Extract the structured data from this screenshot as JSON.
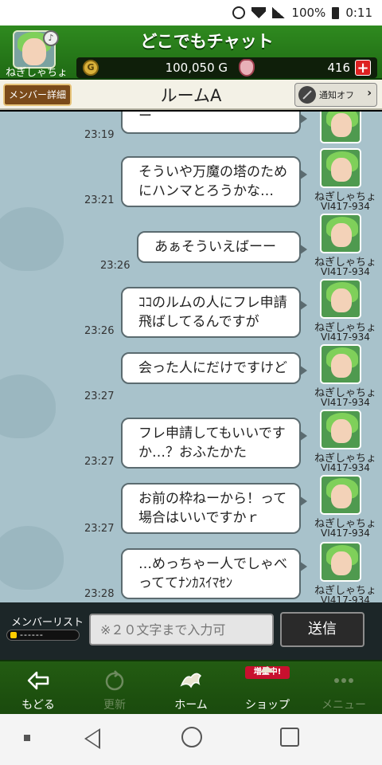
{
  "status_bar": {
    "battery": "100%",
    "time": "0:11"
  },
  "header": {
    "title": "どこでもチャット",
    "player_name": "ねぎしゃちょ",
    "gold_value": "100,050 G",
    "gem_value": "416",
    "coin_icon_text": "G"
  },
  "room_bar": {
    "member_detail_label": "メンバー詳細",
    "room_name": "ルームA",
    "notify_label": "通知オフ",
    "notify_chevron": "›"
  },
  "chat": {
    "partial_top": {
      "text": "ー",
      "time": "23:19"
    },
    "messages": [
      {
        "text": "そういや万魔の塔のためにハンマとろうかな…",
        "time": "23:21",
        "sender": "ねぎしゃちょ",
        "sender_id": "VI417-934"
      },
      {
        "text": "あぁそういえばーー",
        "time": "23:26",
        "sender": "ねぎしゃちょ",
        "sender_id": "VI417-934"
      },
      {
        "text": "ｺｺのルムの人にフレ申請飛ばしてるんですが",
        "time": "23:26",
        "sender": "ねぎしゃちょ",
        "sender_id": "VI417-934"
      },
      {
        "text": "会った人にだけですけど",
        "time": "23:27",
        "sender": "ねぎしゃちょ",
        "sender_id": "VI417-934"
      },
      {
        "text": "フレ申請してもいいですか…？おふたかた",
        "time": "23:27",
        "sender": "ねぎしゃちょ",
        "sender_id": "VI417-934"
      },
      {
        "text": "お前の枠ねーから！って場合はいいですかｒ",
        "time": "23:27",
        "sender": "ねぎしゃちょ",
        "sender_id": "VI417-934"
      },
      {
        "text": "…めっちゃー人でしゃべっててﾅﾝｶｽｲﾏｾﾝ",
        "time": "23:28",
        "sender": "ねぎしゃちょ",
        "sender_id": "VI417-934"
      }
    ]
  },
  "input_bar": {
    "member_list_label": "メンバーリスト",
    "member_list_dashes": "------",
    "input_placeholder": "※２０文字まで入力可",
    "send_label": "送信"
  },
  "bottom_nav": {
    "items": [
      {
        "label": "もどる",
        "icon": "back-arrow-icon",
        "enabled": true
      },
      {
        "label": "更新",
        "icon": "refresh-icon",
        "enabled": false
      },
      {
        "label": "ホーム",
        "icon": "dragon-icon",
        "enabled": true
      },
      {
        "label": "ショップ",
        "icon": "shop-icon",
        "enabled": true,
        "badge": "増量中!"
      },
      {
        "label": "メニュー",
        "icon": "dots-icon",
        "enabled": false
      }
    ]
  },
  "colors": {
    "header_green": "#2f8a1f",
    "chat_bg": "#a8c2cb",
    "nav_green": "#235c12",
    "accent_red": "#dd2222"
  }
}
